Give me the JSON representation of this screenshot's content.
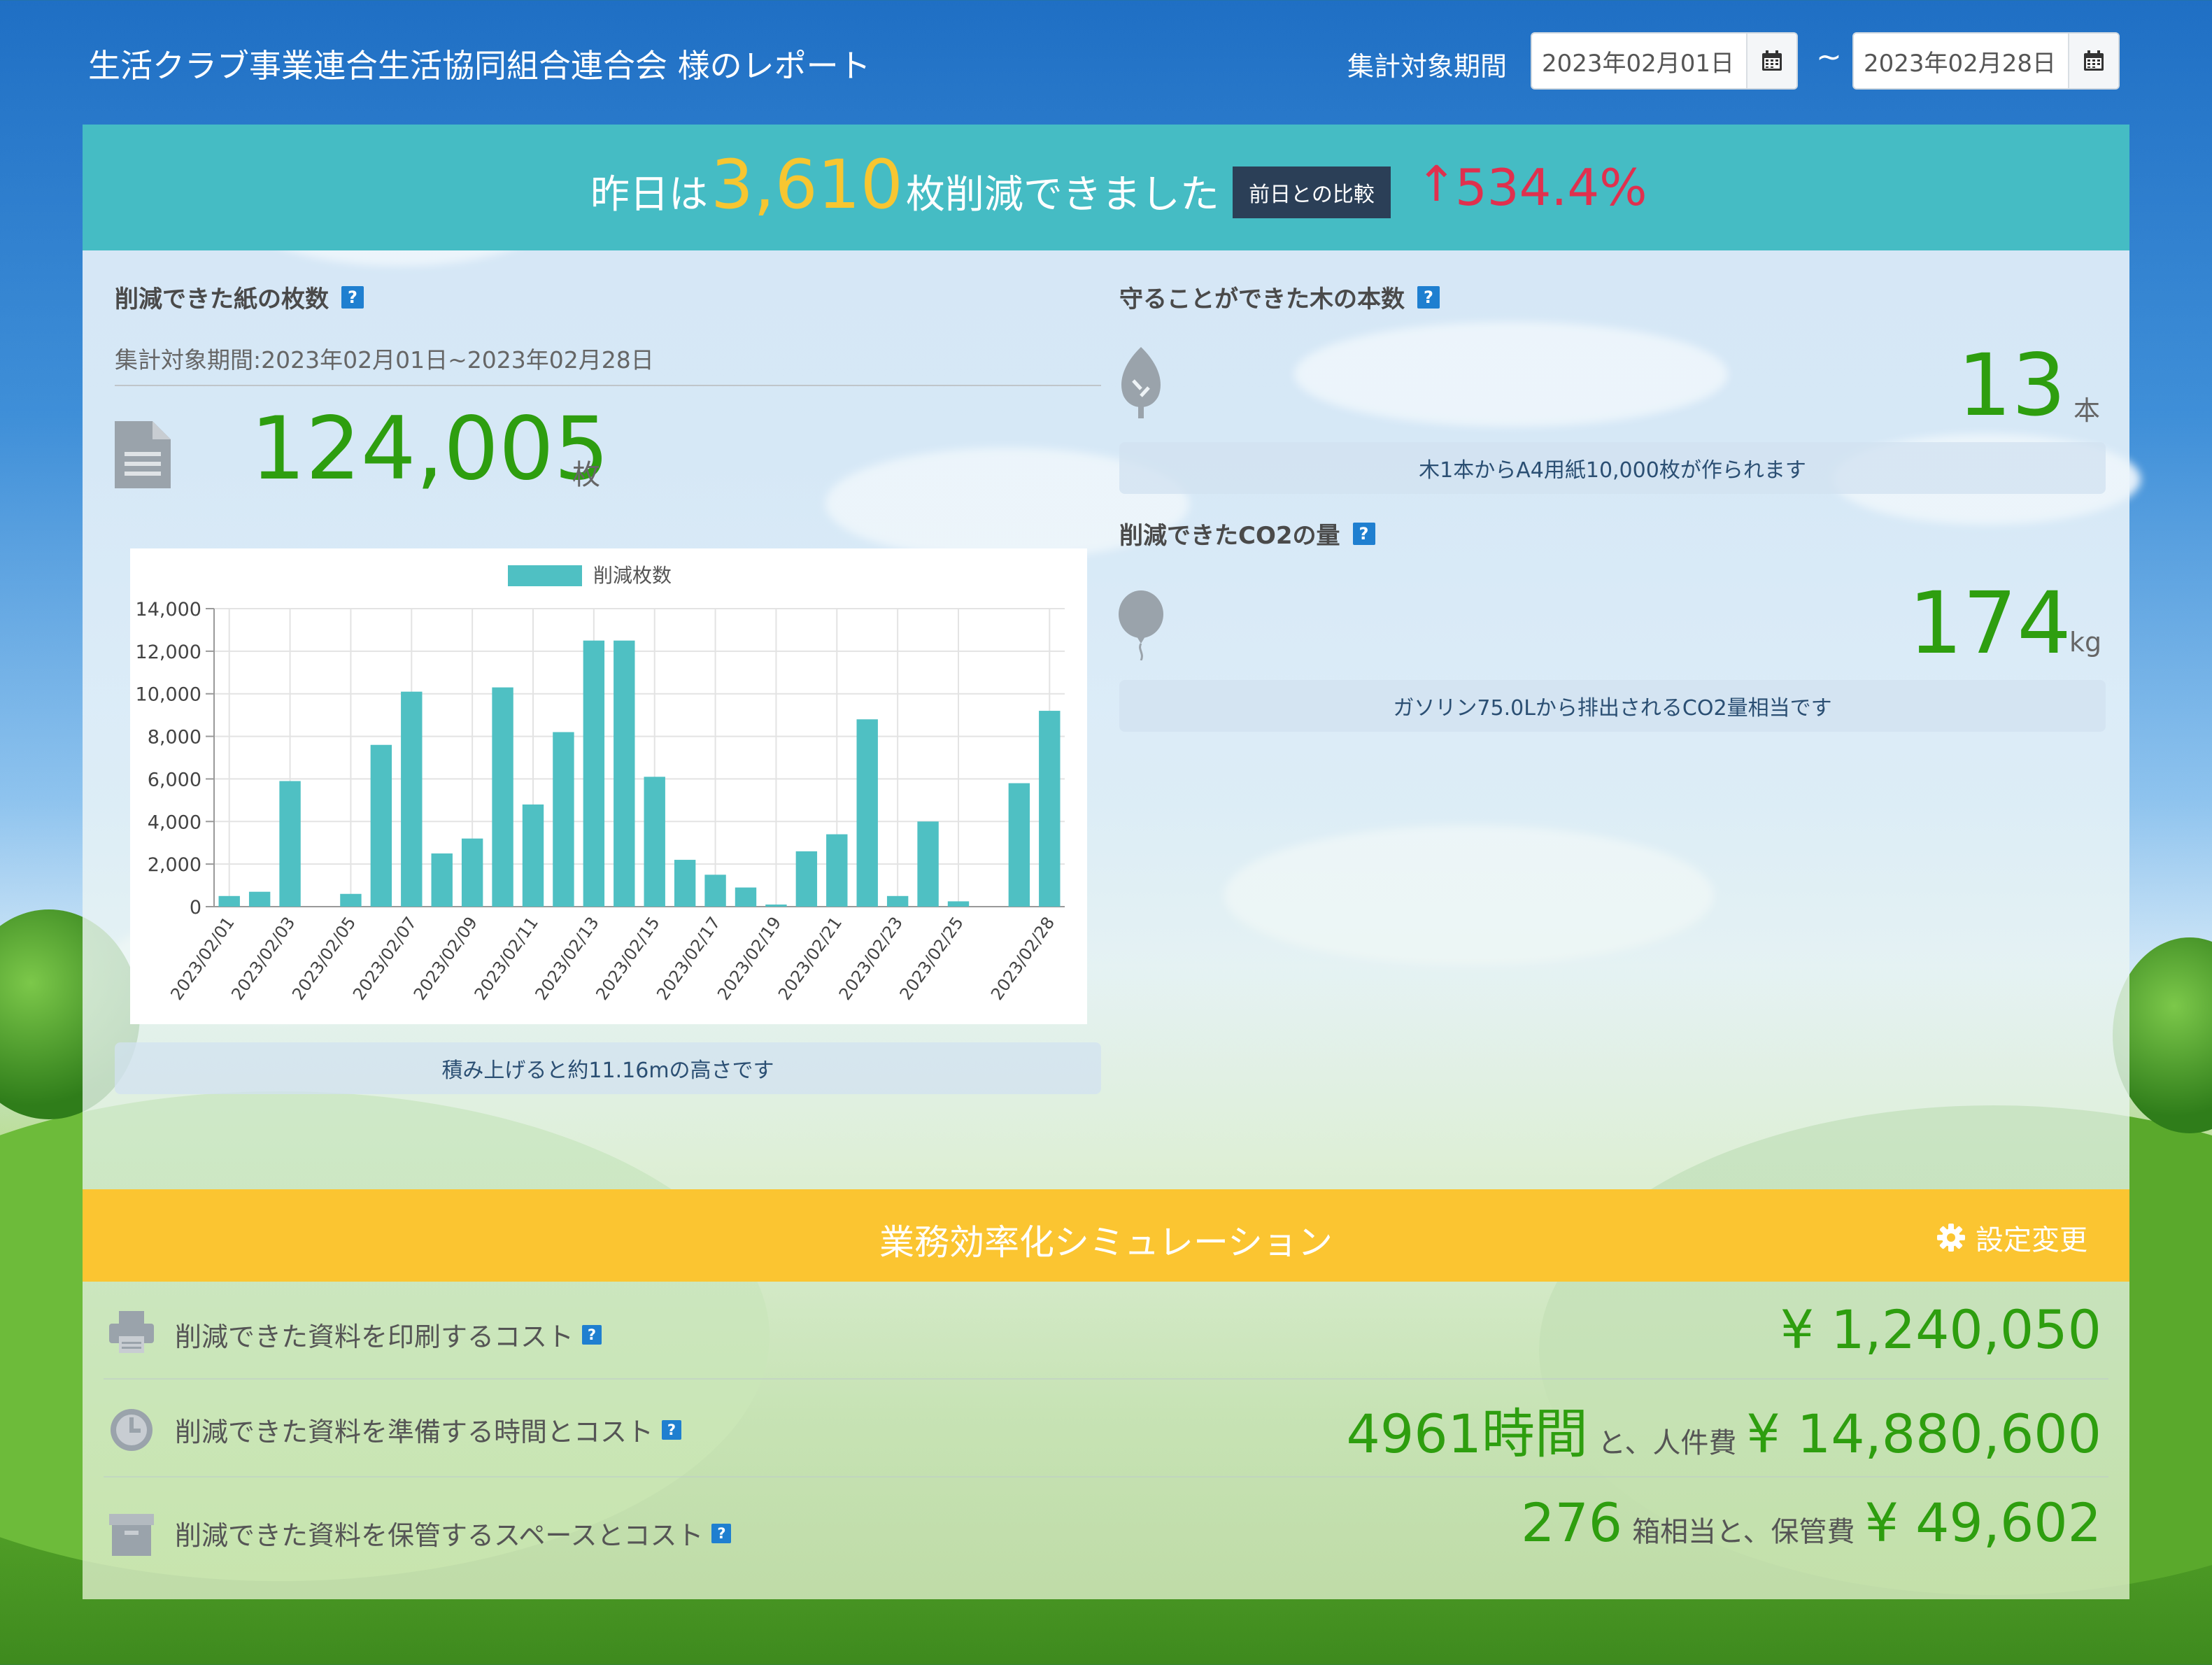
{
  "header": {
    "report_title": "生活クラブ事業連合生活協同組合連合会 様のレポート",
    "period_label": "集計対象期間",
    "date_from": "2023年02月01日",
    "date_to": "2023年02月28日",
    "range_separator": "~"
  },
  "banner": {
    "prefix": "昨日は",
    "count": "3,610",
    "suffix": "枚削減できました",
    "compare_label": "前日との比較",
    "arrow": "↑",
    "change_pct": "534.4%"
  },
  "paper": {
    "title": "削減できた紙の枚数",
    "period": "集計対象期間:2023年02月01日~2023年02月28日",
    "count": "124,005",
    "unit": "枚",
    "height_note": "積み上げると約11.16mの高さです"
  },
  "trees": {
    "title": "守ることができた木の本数",
    "count": "13",
    "unit": "本",
    "note": "木1本からA4用紙10,000枚が作られます"
  },
  "co2": {
    "title": "削減できたCO2の量",
    "amount": "174",
    "unit": "kg",
    "note": "ガソリン75.0Lから排出されるCO2量相当です"
  },
  "chart_data": {
    "type": "bar",
    "legend": "削減枚数",
    "color": "#4fc0c3",
    "ylim": [
      0,
      14000
    ],
    "y_ticks": [
      "0",
      "2,000",
      "4,000",
      "6,000",
      "8,000",
      "10,000",
      "12,000",
      "14,000"
    ],
    "categories": [
      "2023/02/01",
      "2023/02/02",
      "2023/02/03",
      "2023/02/04",
      "2023/02/05",
      "2023/02/06",
      "2023/02/07",
      "2023/02/08",
      "2023/02/09",
      "2023/02/10",
      "2023/02/11",
      "2023/02/12",
      "2023/02/13",
      "2023/02/14",
      "2023/02/15",
      "2023/02/16",
      "2023/02/17",
      "2023/02/18",
      "2023/02/19",
      "2023/02/20",
      "2023/02/21",
      "2023/02/22",
      "2023/02/23",
      "2023/02/24",
      "2023/02/25",
      "2023/02/26",
      "2023/02/27",
      "2023/02/28"
    ],
    "x_tick_labels": [
      "2023/02/01",
      "2023/02/03",
      "2023/02/05",
      "2023/02/07",
      "2023/02/09",
      "2023/02/11",
      "2023/02/13",
      "2023/02/15",
      "2023/02/17",
      "2023/02/19",
      "2023/02/21",
      "2023/02/23",
      "2023/02/25",
      "2023/02/28"
    ],
    "values": [
      500,
      700,
      5900,
      0,
      600,
      7600,
      10100,
      2500,
      3200,
      10300,
      4800,
      8200,
      12500,
      12500,
      6100,
      2200,
      1500,
      900,
      100,
      2600,
      3400,
      8800,
      500,
      4000,
      250,
      0,
      5800,
      9200
    ]
  },
  "simulation": {
    "title": "業務効率化シミュレーション",
    "settings_label": "設定変更",
    "rows": [
      {
        "label": "削減できた資料を印刷するコスト",
        "value": "¥ 1,240,050"
      },
      {
        "label": "削減できた資料を準備する時間とコスト",
        "hours": "4961時間",
        "connector": "と、人件費",
        "value": "¥ 14,880,600"
      },
      {
        "label": "削減できた資料を保管するスペースとコスト",
        "boxes": "276",
        "connector": "箱相当と、保管費",
        "value": "¥ 49,602"
      }
    ]
  },
  "icons": {
    "calendar": "calendar-icon",
    "help": "help-icon",
    "document": "document-icon",
    "tree": "tree-icon",
    "balloon": "balloon-icon",
    "gear": "gear-icon",
    "printer": "printer-icon",
    "clock": "clock-icon",
    "box": "box-icon"
  }
}
